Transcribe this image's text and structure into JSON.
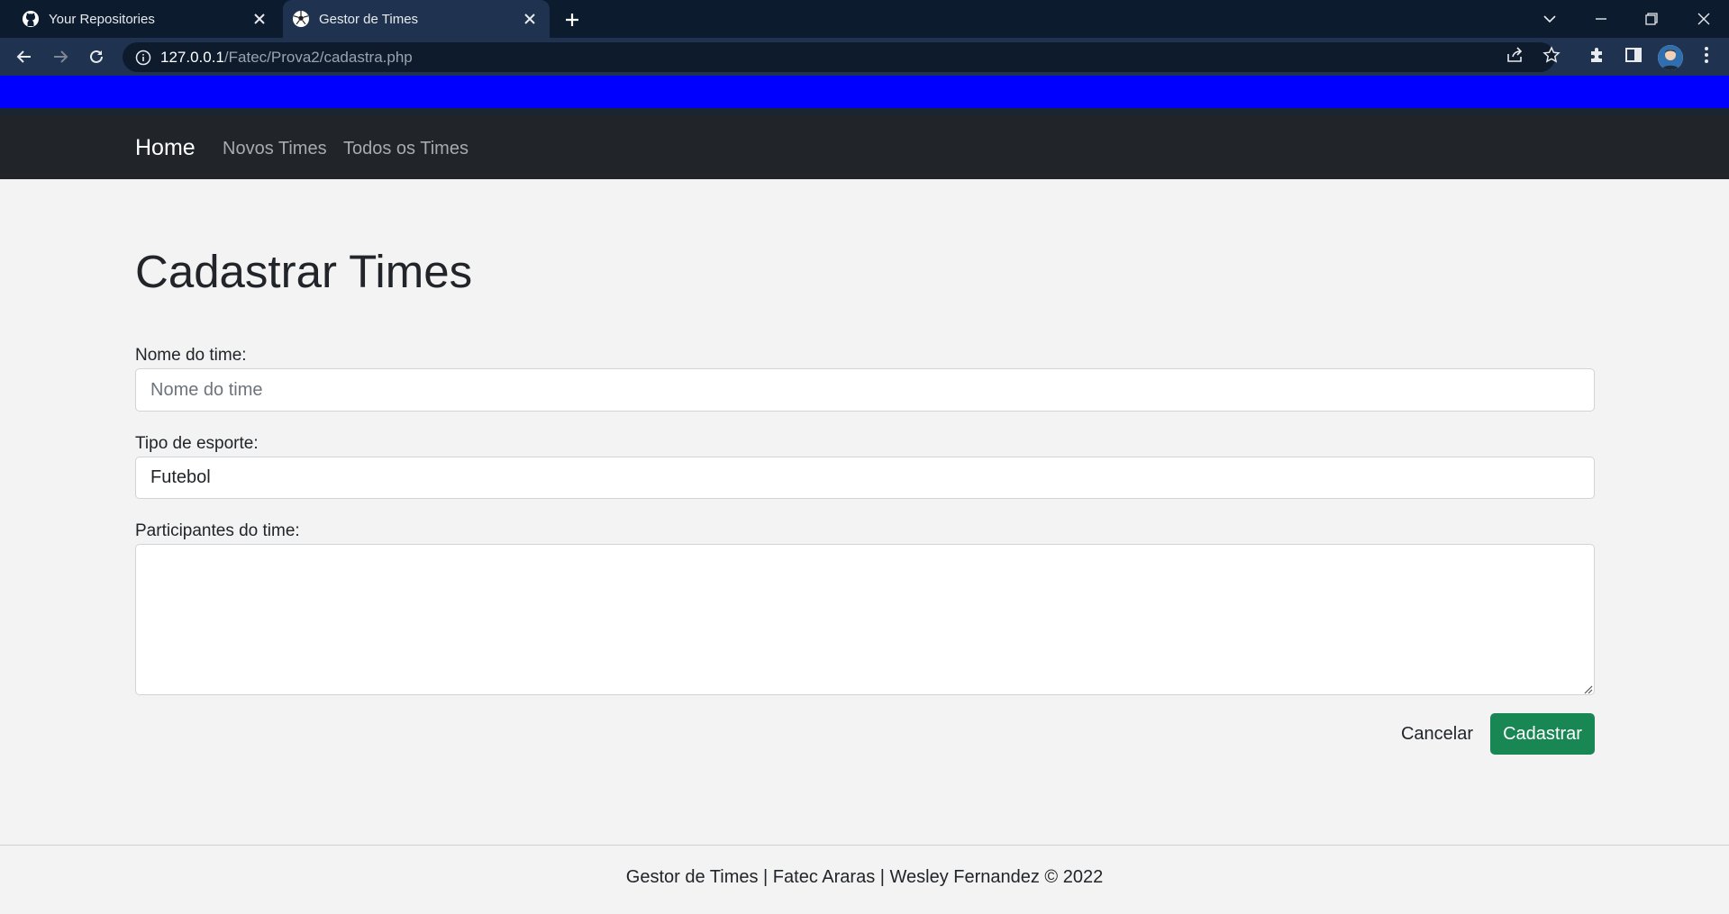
{
  "browser": {
    "tabs": [
      {
        "title": "Your Repositories",
        "icon": "github-icon",
        "active": false
      },
      {
        "title": "Gestor de Times",
        "icon": "soccer-ball-icon",
        "active": true
      }
    ],
    "address": {
      "host": "127.0.0.1",
      "path": "/Fatec/Prova2/cadastra.php"
    }
  },
  "navbar": {
    "brand": "Home",
    "links": [
      "Novos Times",
      "Todos os Times"
    ]
  },
  "form": {
    "title": "Cadastrar Times",
    "name_label": "Nome do time:",
    "name_placeholder": "Nome do time",
    "name_value": "",
    "sport_label": "Tipo de esporte:",
    "sport_value": "Futebol",
    "members_label": "Participantes do time:",
    "members_value": "",
    "cancel_label": "Cancelar",
    "submit_label": "Cadastrar"
  },
  "footer": {
    "text": "Gestor de Times | Fatec Araras | Wesley Fernandez © 2022"
  },
  "colors": {
    "tabbar": "#0d1b2e",
    "toolbar": "#1f3350",
    "banner": "#0000ff",
    "navbar": "#212529",
    "submit_button": "#198754",
    "page_background": "#f3f3f3"
  }
}
